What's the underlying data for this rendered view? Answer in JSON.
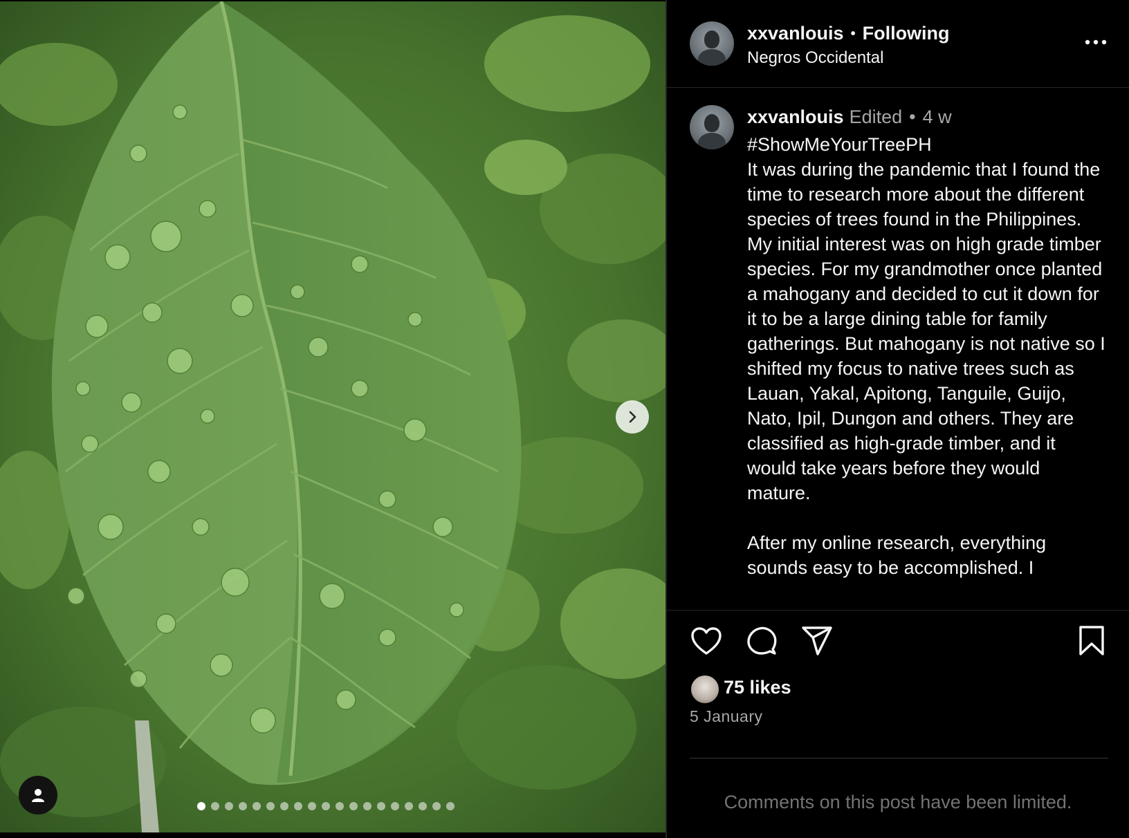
{
  "header": {
    "username": "xxvanlouis",
    "separator": "•",
    "follow_status": "Following",
    "location": "Negros Occidental",
    "more_icon": "more-horizontal-icon"
  },
  "caption": {
    "username": "xxvanlouis",
    "edited": "Edited",
    "separator": "•",
    "time_ago": "4 w",
    "text": "#ShowMeYourTreePH\nIt was during the pandemic that I found the time to research more about the different species of trees found in the Philippines. My initial interest was on high grade timber species. For my grandmother once planted a mahogany and decided to cut it down for it to be a large dining table for family gatherings. But mahogany is not native so I shifted my focus to native trees such as Lauan, Yakal, Apitong, Tanguile, Guijo, Nato, Ipil, Dungon and others. They are classified as high-grade timber, and it would take years before they would mature.\n\nAfter my online research, everything sounds easy to be accomplished. I"
  },
  "actions": {
    "like_icon": "heart-icon",
    "comment_icon": "comment-bubble-icon",
    "share_icon": "paper-plane-icon",
    "save_icon": "bookmark-icon"
  },
  "likes": "75 likes",
  "date": "5 January",
  "comments_notice": "Comments on this post have been limited.",
  "media": {
    "next_icon": "chevron-right-icon",
    "user_tag_icon": "person-icon",
    "carousel_count": 19,
    "carousel_active_index": 0
  },
  "colors": {
    "background": "#000000",
    "text_primary": "#f5f5f5",
    "text_secondary": "#a8a8a8",
    "text_muted": "#737373",
    "divider": "#262626",
    "leaf_green": "#6a9a4c"
  }
}
